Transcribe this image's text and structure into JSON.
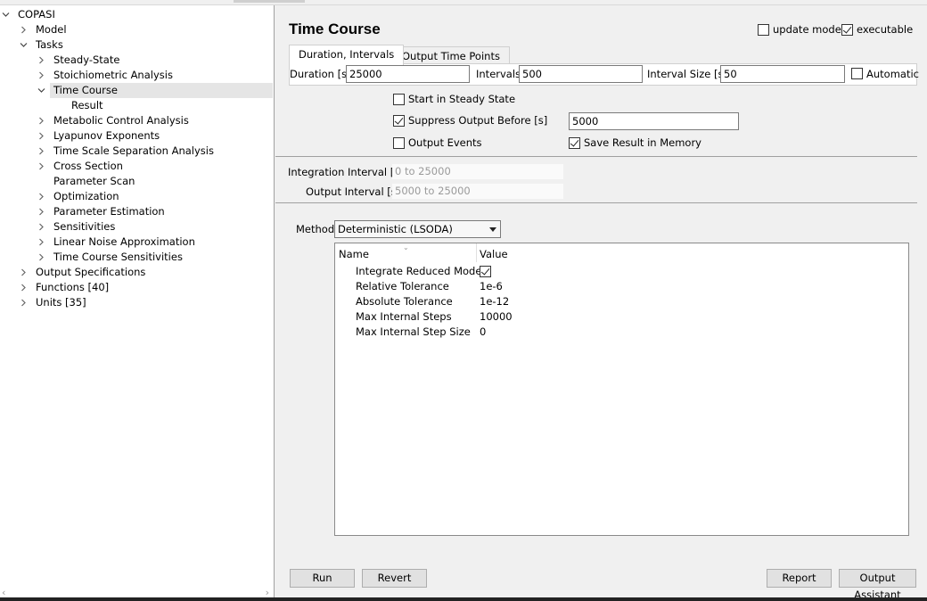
{
  "sidebar": {
    "root": "COPASI",
    "items": [
      {
        "label": "Model",
        "depth": 1,
        "arrow": "right"
      },
      {
        "label": "Tasks",
        "depth": 1,
        "arrow": "down"
      },
      {
        "label": "Steady-State",
        "depth": 2,
        "arrow": "right"
      },
      {
        "label": "Stoichiometric Analysis",
        "depth": 2,
        "arrow": "right"
      },
      {
        "label": "Time Course",
        "depth": 2,
        "arrow": "down",
        "selected": true
      },
      {
        "label": "Result",
        "depth": 3,
        "arrow": "none"
      },
      {
        "label": "Metabolic Control Analysis",
        "depth": 2,
        "arrow": "right"
      },
      {
        "label": "Lyapunov Exponents",
        "depth": 2,
        "arrow": "right"
      },
      {
        "label": "Time Scale Separation Analysis",
        "depth": 2,
        "arrow": "right"
      },
      {
        "label": "Cross Section",
        "depth": 2,
        "arrow": "right"
      },
      {
        "label": "Parameter Scan",
        "depth": 2,
        "arrow": "none"
      },
      {
        "label": "Optimization",
        "depth": 2,
        "arrow": "right"
      },
      {
        "label": "Parameter Estimation",
        "depth": 2,
        "arrow": "right"
      },
      {
        "label": "Sensitivities",
        "depth": 2,
        "arrow": "right"
      },
      {
        "label": "Linear Noise Approximation",
        "depth": 2,
        "arrow": "right"
      },
      {
        "label": "Time Course Sensitivities",
        "depth": 2,
        "arrow": "right"
      },
      {
        "label": "Output Specifications",
        "depth": 1,
        "arrow": "right"
      },
      {
        "label": "Functions [40]",
        "depth": 1,
        "arrow": "right"
      },
      {
        "label": "Units [35]",
        "depth": 1,
        "arrow": "right"
      }
    ]
  },
  "header": {
    "title": "Time Course",
    "update_model_label": "update model",
    "update_model_checked": false,
    "executable_label": "executable",
    "executable_checked": true
  },
  "tabs": [
    {
      "label": "Duration, Intervals",
      "active": true
    },
    {
      "label": "Output Time Points",
      "active": false
    }
  ],
  "duration": {
    "duration_label": "Duration [s]",
    "duration_value": "25000",
    "intervals_label": "Intervals",
    "intervals_value": "500",
    "interval_size_label": "Interval Size [s]",
    "interval_size_value": "50",
    "automatic_label": "Automatic",
    "automatic_checked": false
  },
  "options": {
    "start_steady_label": "Start in Steady State",
    "start_steady_checked": false,
    "suppress_label": "Suppress Output Before [s]",
    "suppress_checked": true,
    "suppress_value": "5000",
    "output_events_label": "Output Events",
    "output_events_checked": false,
    "save_result_label": "Save Result in Memory",
    "save_result_checked": true
  },
  "intervals": {
    "integration_label": "Integration Interval [s]",
    "integration_value": "0 to 25000",
    "output_label": "Output Interval [s]",
    "output_value": "5000 to 25000"
  },
  "method": {
    "label": "Method",
    "selected": "Deterministic (LSODA)"
  },
  "table": {
    "col_name": "Name",
    "col_value": "Value",
    "rows": [
      {
        "name": "Integrate Reduced Model",
        "value": "",
        "checkbox": true
      },
      {
        "name": "Relative Tolerance",
        "value": "1e-6"
      },
      {
        "name": "Absolute Tolerance",
        "value": "1e-12"
      },
      {
        "name": "Max Internal Steps",
        "value": "10000"
      },
      {
        "name": "Max Internal Step Size",
        "value": "0"
      }
    ]
  },
  "buttons": {
    "run": "Run",
    "revert": "Revert",
    "report": "Report",
    "output_assistant": "Output Assistant"
  }
}
